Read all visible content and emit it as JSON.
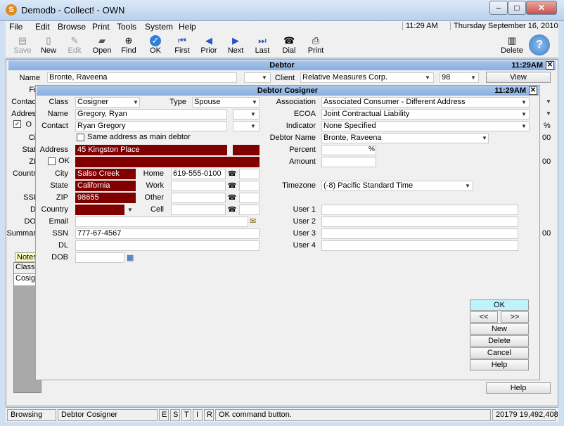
{
  "window": {
    "title": "Demodb - Collect! - OWN",
    "minimize": "–",
    "maximize": "□",
    "close": "✕"
  },
  "menu": [
    "File",
    "Edit",
    "Browse",
    "Print",
    "Tools",
    "System",
    "Help"
  ],
  "clock": {
    "time": "11:29 AM",
    "date": "Thursday  September 16, 2010"
  },
  "toolbar": {
    "save": "Save",
    "new": "New",
    "edit": "Edit",
    "open": "Open",
    "find": "Find",
    "ok": "OK",
    "first": "First",
    "prior": "Prior",
    "next": "Next",
    "last": "Last",
    "dial": "Dial",
    "print": "Print",
    "delete": "Delete"
  },
  "debtor": {
    "title": "Debtor",
    "time": "11:29AM",
    "labels": {
      "name": "Name",
      "file": "Fil",
      "contact": "Contac",
      "address": "Addres",
      "o": "O",
      "city": "Ci",
      "state": "Stat",
      "zip": "ZI",
      "country": "Countr",
      "ssn": "SSI",
      "d": "D",
      "do": "DO",
      "summary": "Summar",
      "client": "Client"
    },
    "name": "Bronte, Raveena",
    "client": "Relative Measures Corp.",
    "client_no": "98",
    "view": "View",
    "notes_tab": "Notes",
    "col_class": "Class",
    "row_class": "Cosigr",
    "help": "Help",
    "right_vals": [
      "00",
      "%",
      "00",
      "00"
    ]
  },
  "cosigner": {
    "title": "Debtor Cosigner",
    "time": "11:29AM",
    "labels": {
      "class": "Class",
      "type": "Type",
      "name": "Name",
      "contact": "Contact",
      "address": "Address",
      "ok": "OK",
      "city": "City",
      "state": "State",
      "zip": "ZIP",
      "country": "Country",
      "email": "Email",
      "ssn": "SSN",
      "dl": "DL",
      "dob": "DOB",
      "home": "Home",
      "work": "Work",
      "other": "Other",
      "cell": "Cell",
      "association": "Association",
      "ecoa": "ECOA",
      "indicator": "Indicator",
      "debtor_name": "Debtor Name",
      "percent": "Percent",
      "amount": "Amount",
      "timezone": "Timezone",
      "user1": "User 1",
      "user2": "User 2",
      "user3": "User 3",
      "user4": "User 4"
    },
    "same_address": "Same address as main debtor",
    "class": "Cosigner",
    "type": "Spouse",
    "name": "Gregory, Ryan",
    "contact": "Ryan Gregory",
    "address": "45 Kingston Place",
    "city": "Salso Creek",
    "state": "California",
    "zip": "98655",
    "home": "619-555-0100",
    "ssn": "777-67-4567",
    "association": "Associated Consumer - Different Address",
    "ecoa": "Joint Contractual Liability",
    "indicator": "None Specified",
    "debtor_name": "Bronte, Raveena",
    "percent_sign": "%",
    "timezone": "(-8) Pacific Standard Time",
    "buttons": {
      "ok": "OK",
      "prev": "<<",
      "next": ">>",
      "new": "New",
      "delete": "Delete",
      "cancel": "Cancel",
      "help": "Help"
    }
  },
  "status": {
    "mode": "Browsing",
    "form": "Debtor Cosigner",
    "flags": [
      "E",
      "S",
      "T",
      "I",
      "R"
    ],
    "message": "OK command button.",
    "right": "20179 19,492,408"
  }
}
